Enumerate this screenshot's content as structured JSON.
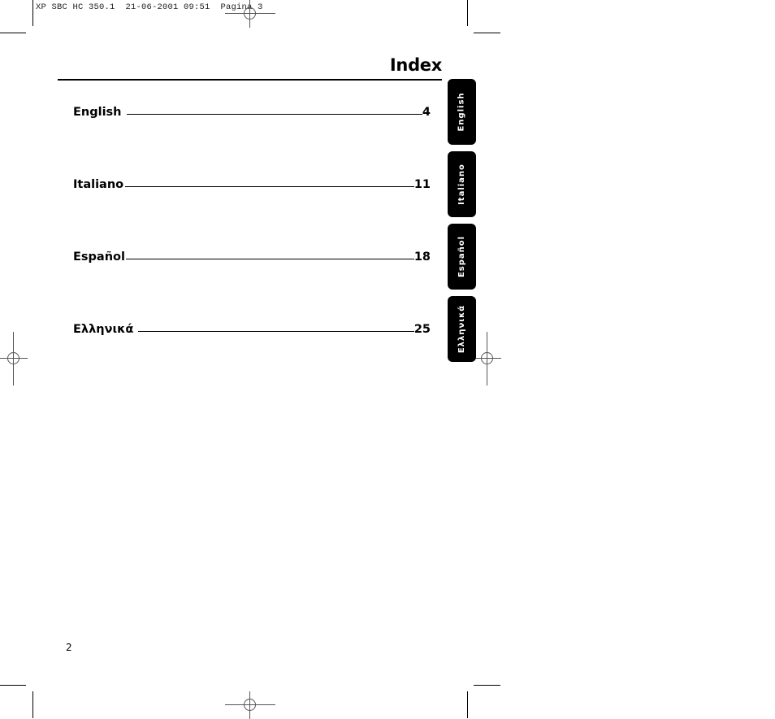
{
  "slug": {
    "text": "XP SBC HC 350.1  21-06-2001 09:51  Pagina 3"
  },
  "header": {
    "title": "Index"
  },
  "toc": {
    "entries": [
      {
        "label": "English",
        "page": "4"
      },
      {
        "label": "Italiano",
        "page": "11"
      },
      {
        "label": "Español",
        "page": "18"
      },
      {
        "label": "Ελληνικά",
        "page": "25"
      }
    ]
  },
  "tabs": {
    "items": [
      {
        "label": "English"
      },
      {
        "label": "Italiano"
      },
      {
        "label": "Español"
      },
      {
        "label": "Ελληνικά"
      }
    ],
    "color": "#000000"
  },
  "footer": {
    "page_number": "2"
  }
}
